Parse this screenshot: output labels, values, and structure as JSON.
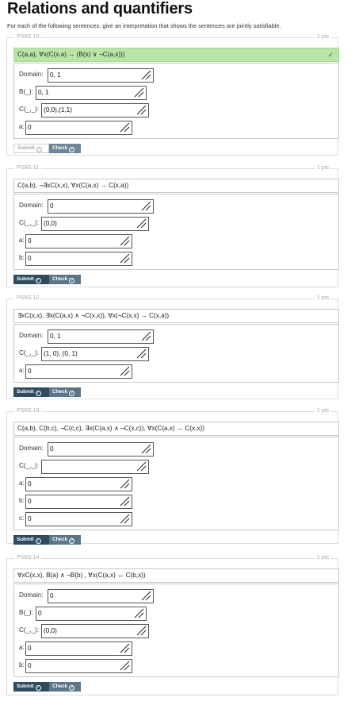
{
  "page": {
    "title": "Relations and quantifiers",
    "intro": "For each of the following sentences, give an interpretation that shows the sentences are jointly satisfiable."
  },
  "buttons": {
    "submit": "Submit",
    "check": "Check"
  },
  "icons": {
    "check_icon": "check-circle",
    "help_icon": "question-circle",
    "resize_icon": "resize-handle"
  },
  "colors": {
    "correct_bg": "#b9e6a8",
    "submit_bg": "#2e4b60",
    "check_bg": "#5c7689"
  },
  "problems": [
    {
      "id": "PS6G.10",
      "pts": "1 pts",
      "correct": true,
      "submit_disabled": true,
      "statement": "C(a,a), ∀x(C(x,a) → (B(x) ∨ ¬C(a,x)))",
      "fields": [
        {
          "label": "Domain:",
          "value": "0, 1"
        },
        {
          "label": "B(_):",
          "value": "0, 1"
        },
        {
          "label": "C(_,_):",
          "value": "(0,0),(1,1)"
        },
        {
          "label": "a:",
          "value": "0"
        }
      ]
    },
    {
      "id": "PS6G.11",
      "pts": "1 pts",
      "correct": false,
      "submit_disabled": false,
      "statement": "C(a,b), ¬∃xC(x,x), ∀x(C(a,x) → C(x,a))",
      "fields": [
        {
          "label": "Domain:",
          "value": "0"
        },
        {
          "label": "C(_,_):",
          "value": "(0,0)"
        },
        {
          "label": "a:",
          "value": "0"
        },
        {
          "label": "b:",
          "value": "0"
        }
      ]
    },
    {
      "id": "PS6G.12",
      "pts": "1 pts",
      "correct": false,
      "submit_disabled": false,
      "statement": "∃xC(x,x), ∃x(C(a,x) ∧ ¬C(x,x)), ∀x(¬C(x,x) → C(x,a))",
      "fields": [
        {
          "label": "Domain:",
          "value": "0, 1"
        },
        {
          "label": "C(_,_):",
          "value": "(1, 0), (0, 1)"
        },
        {
          "label": "a:",
          "value": "0"
        }
      ]
    },
    {
      "id": "PS6G.13",
      "pts": "1 pts",
      "correct": false,
      "submit_disabled": false,
      "statement": "C(a,b), C(b,c), ¬C(c,c), ∃x(C(a,x) ∧ ¬C(x,c)), ∀x(C(a,x) → C(x,x))",
      "fields": [
        {
          "label": "Domain:",
          "value": "0"
        },
        {
          "label": "C(_,_):",
          "value": ""
        },
        {
          "label": "a:",
          "value": "0"
        },
        {
          "label": "b:",
          "value": "0"
        },
        {
          "label": "c:",
          "value": "0"
        }
      ]
    },
    {
      "id": "PS6G.14",
      "pts": "1 pts",
      "correct": false,
      "submit_disabled": false,
      "statement": "∀xC(x,x), B(a) ∧ ¬B(b) , ∀x(C(a,x) ↔ C(b,x))",
      "fields": [
        {
          "label": "Domain:",
          "value": "0"
        },
        {
          "label": "B(_):",
          "value": "0"
        },
        {
          "label": "C(_,_):",
          "value": "(0,0)"
        },
        {
          "label": "a:",
          "value": "0"
        },
        {
          "label": "b:",
          "value": "0"
        }
      ]
    }
  ]
}
